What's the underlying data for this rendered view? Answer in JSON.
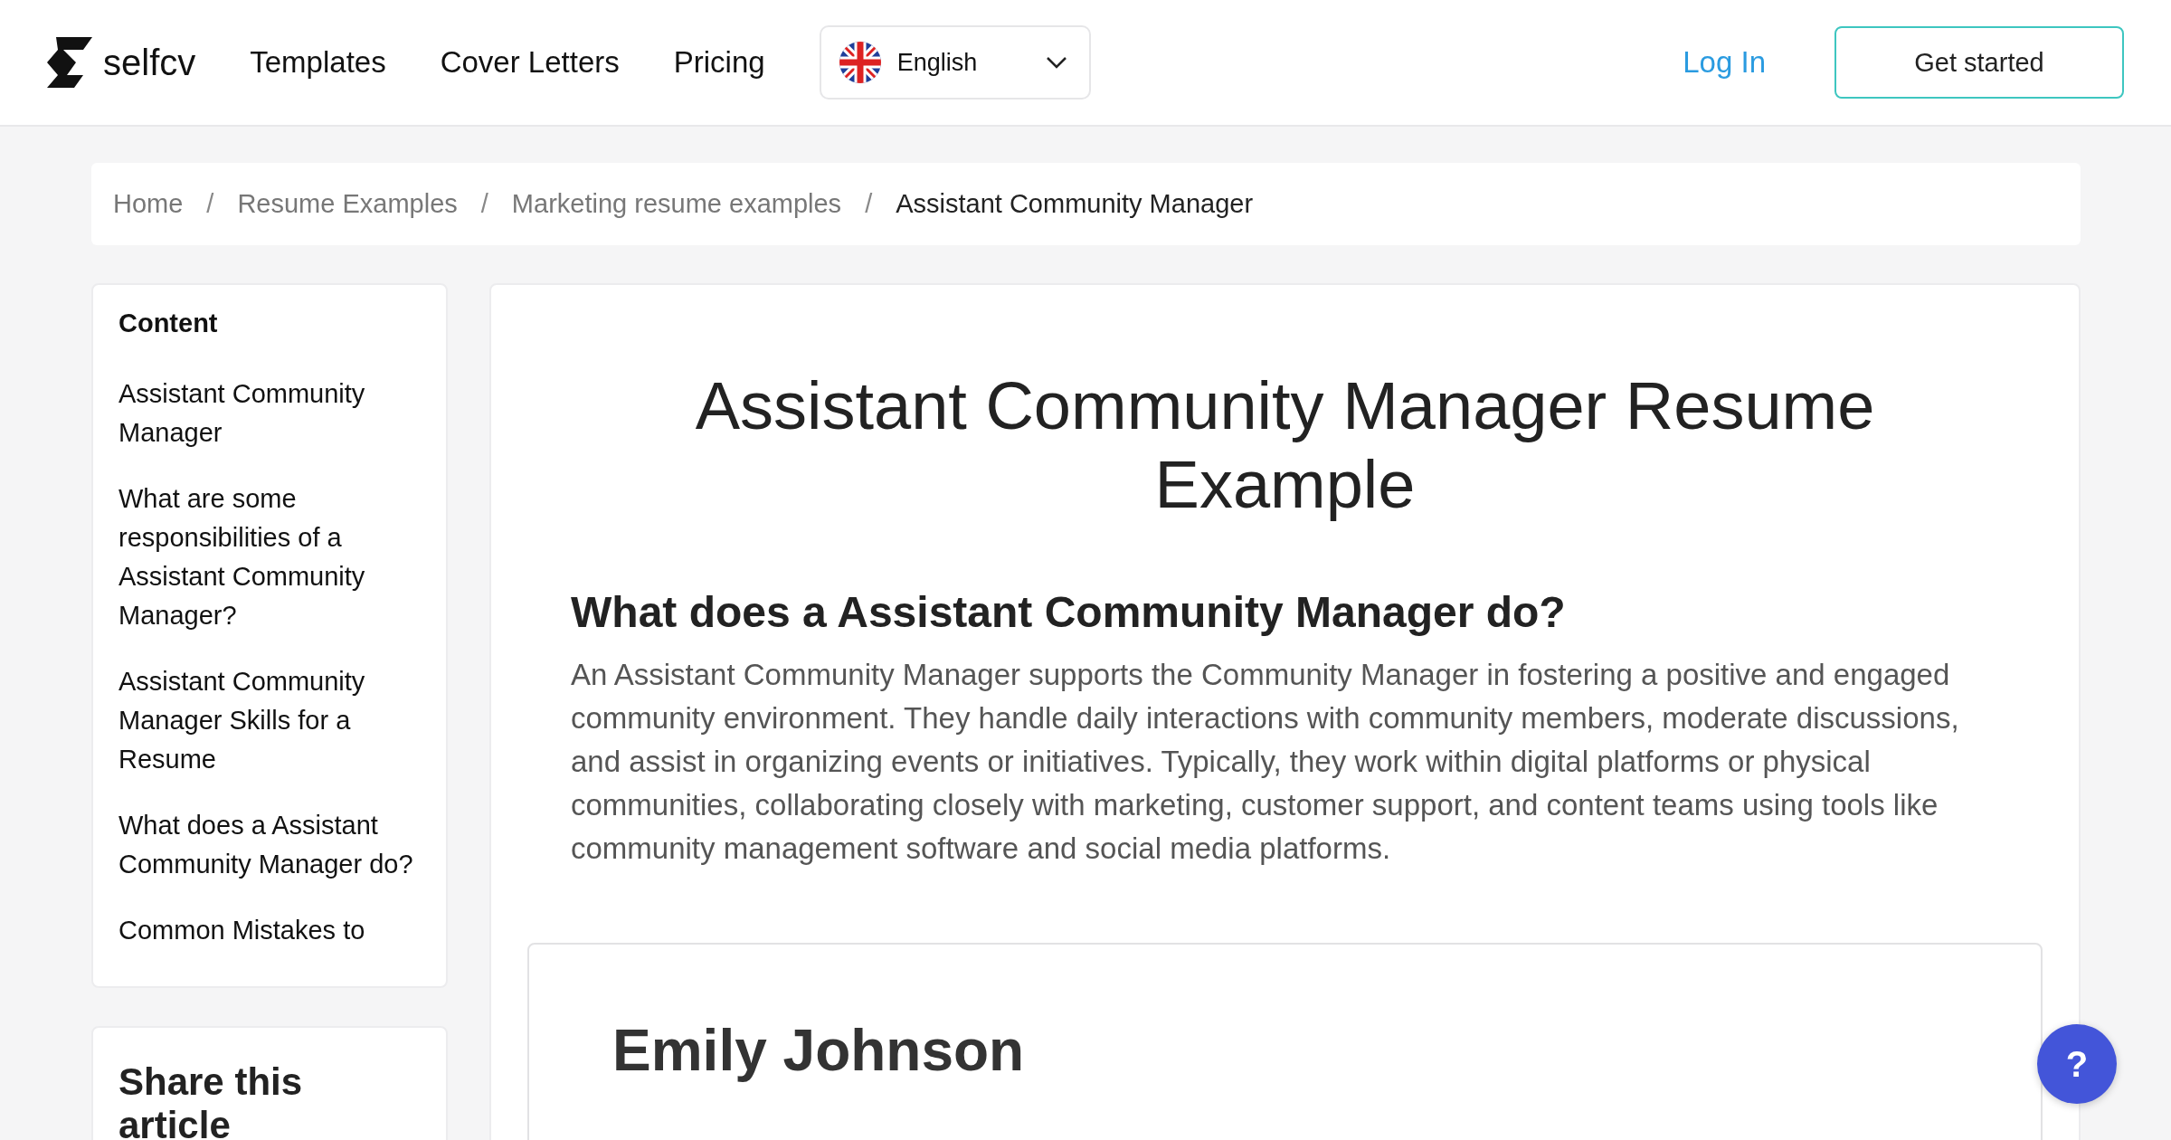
{
  "header": {
    "logo": "selfcv",
    "nav": [
      "Templates",
      "Cover Letters",
      "Pricing"
    ],
    "language": "English",
    "login": "Log In",
    "cta": "Get started"
  },
  "breadcrumb": [
    {
      "label": "Home",
      "current": false
    },
    {
      "label": "Resume Examples",
      "current": false
    },
    {
      "label": "Marketing resume examples",
      "current": false
    },
    {
      "label": "Assistant Community Manager",
      "current": true
    }
  ],
  "breadcrumb_separator": "/",
  "toc": {
    "title": "Content",
    "items": [
      "Assistant Community Manager",
      "What are some responsibilities of a Assistant Community Manager?",
      "Assistant Community Manager Skills for a Resume",
      "What does a Assistant Community Manager do?",
      "Common Mistakes to"
    ]
  },
  "share": {
    "title": "Share this article"
  },
  "article": {
    "title": "Assistant Community Manager Resume Example",
    "heading": "What does a Assistant Community Manager do?",
    "paragraph": "An Assistant Community Manager supports the Community Manager in fostering a positive and engaged community environment. They handle daily interactions with community members, moderate discussions, and assist in organizing events or initiatives. Typically, they work within digital platforms or physical communities, collaborating closely with marketing, customer support, and content teams using tools like community management software and social media platforms."
  },
  "resume": {
    "name": "Emily Johnson"
  },
  "help_button": "?"
}
